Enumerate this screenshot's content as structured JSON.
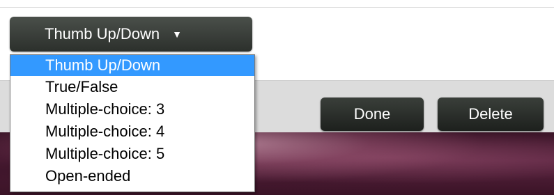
{
  "select": {
    "current": "Thumb Up/Down",
    "caret": "▼"
  },
  "buttons": {
    "done": "Done",
    "delete": "Delete"
  },
  "dropdown": {
    "options": [
      "Thumb Up/Down",
      "True/False",
      "Multiple-choice: 3",
      "Multiple-choice: 4",
      "Multiple-choice: 5",
      "Open-ended"
    ],
    "selected_index": 0,
    "highlight_color": "#3399ff"
  }
}
